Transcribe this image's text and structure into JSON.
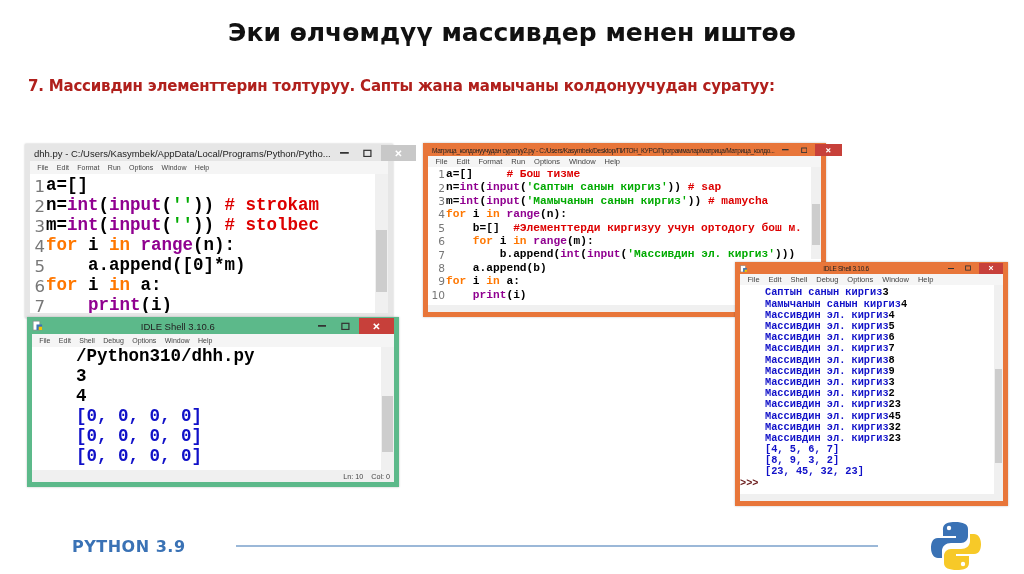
{
  "slide_title": "Эки өлчөмдүү массивдер менен иштөө",
  "subtitle": "7. Массивдин элементтерин толтуруу. Сапты жана мамычаны колдонуучудан суратуу:",
  "windows": [
    {
      "kind": "editor",
      "title": "dhh.py - C:/Users/Kasymbek/AppData/Local/Programs/Python/Pytho...",
      "color": "#e6e6e6",
      "active": false,
      "menu": [
        "File",
        "Edit",
        "Format",
        "Run",
        "Options",
        "Window",
        "Help"
      ],
      "lines": [
        {
          "number": "1",
          "tokens": [
            {
              "kind": "plain",
              "text": "a=[]"
            }
          ]
        },
        {
          "number": "2",
          "tokens": [
            {
              "kind": "plain",
              "text": "n="
            },
            {
              "kind": "builtin",
              "text": "int"
            },
            {
              "kind": "plain",
              "text": "("
            },
            {
              "kind": "builtin",
              "text": "input"
            },
            {
              "kind": "plain",
              "text": "("
            },
            {
              "kind": "string",
              "text": "''"
            },
            {
              "kind": "plain",
              "text": ")) "
            },
            {
              "kind": "comment",
              "text": "# strokam"
            }
          ]
        },
        {
          "number": "3",
          "tokens": [
            {
              "kind": "plain",
              "text": "m="
            },
            {
              "kind": "builtin",
              "text": "int"
            },
            {
              "kind": "plain",
              "text": "("
            },
            {
              "kind": "builtin",
              "text": "input"
            },
            {
              "kind": "plain",
              "text": "("
            },
            {
              "kind": "string",
              "text": "''"
            },
            {
              "kind": "plain",
              "text": ")) "
            },
            {
              "kind": "comment",
              "text": "# stolbec"
            }
          ]
        },
        {
          "number": "4",
          "tokens": [
            {
              "kind": "keyword",
              "text": "for"
            },
            {
              "kind": "plain",
              "text": " i "
            },
            {
              "kind": "keyword",
              "text": "in"
            },
            {
              "kind": "builtin",
              "text": " range"
            },
            {
              "kind": "plain",
              "text": "(n):"
            }
          ]
        },
        {
          "number": "5",
          "tokens": [
            {
              "kind": "plain",
              "text": "    a.append([0]*m)"
            }
          ]
        },
        {
          "number": "6",
          "tokens": [
            {
              "kind": "keyword",
              "text": "for"
            },
            {
              "kind": "plain",
              "text": " i "
            },
            {
              "kind": "keyword",
              "text": "in"
            },
            {
              "kind": "plain",
              "text": " a:"
            }
          ]
        },
        {
          "number": "7",
          "tokens": [
            {
              "kind": "builtin",
              "text": "    print"
            },
            {
              "kind": "plain",
              "text": "(i)"
            }
          ]
        }
      ]
    },
    {
      "kind": "shell",
      "title": "IDLE Shell 3.10.6",
      "color": "#5cb98a",
      "active": true,
      "menu": [
        "File",
        "Edit",
        "Shell",
        "Debug",
        "Options",
        "Window",
        "Help"
      ],
      "lines": [
        {
          "tokens": [
            {
              "kind": "plain",
              "text": "/Python310/dhh.py"
            }
          ]
        },
        {
          "tokens": [
            {
              "kind": "input",
              "text": "3"
            }
          ]
        },
        {
          "tokens": [
            {
              "kind": "input",
              "text": "4"
            }
          ]
        },
        {
          "tokens": [
            {
              "kind": "output",
              "text": "[0, 0, 0, 0]"
            }
          ]
        },
        {
          "tokens": [
            {
              "kind": "output",
              "text": "[0, 0, 0, 0]"
            }
          ]
        },
        {
          "tokens": [
            {
              "kind": "output",
              "text": "[0, 0, 0, 0]"
            }
          ]
        }
      ],
      "status": [
        "Ln: 10",
        "Col: 0"
      ]
    },
    {
      "kind": "editor",
      "title": "Матрица_колдонуучудан суратуу2.py - C:/Users/Kasymbek/Desktop/ПИТОН_КУРС/Программалар/матрица/Матрица_колдо...",
      "color": "#e8763a",
      "active": true,
      "menu": [
        "File",
        "Edit",
        "Format",
        "Run",
        "Options",
        "Window",
        "Help"
      ],
      "lines": [
        {
          "number": "1",
          "tokens": [
            {
              "kind": "plain",
              "text": "a=[]     "
            },
            {
              "kind": "comment",
              "text": "# Бош тизме"
            }
          ]
        },
        {
          "number": "2",
          "tokens": [
            {
              "kind": "plain",
              "text": "n="
            },
            {
              "kind": "builtin",
              "text": "int"
            },
            {
              "kind": "plain",
              "text": "("
            },
            {
              "kind": "builtin",
              "text": "input"
            },
            {
              "kind": "plain",
              "text": "("
            },
            {
              "kind": "string",
              "text": "'Саптын санын киргиз'"
            },
            {
              "kind": "plain",
              "text": ")) "
            },
            {
              "kind": "comment",
              "text": "# sap"
            }
          ]
        },
        {
          "number": "3",
          "tokens": [
            {
              "kind": "plain",
              "text": "m="
            },
            {
              "kind": "builtin",
              "text": "int"
            },
            {
              "kind": "plain",
              "text": "("
            },
            {
              "kind": "builtin",
              "text": "input"
            },
            {
              "kind": "plain",
              "text": "("
            },
            {
              "kind": "string",
              "text": "'Мамычанын санын киргиз'"
            },
            {
              "kind": "plain",
              "text": ")) "
            },
            {
              "kind": "comment",
              "text": "# mamycha"
            }
          ]
        },
        {
          "number": "4",
          "tokens": [
            {
              "kind": "keyword",
              "text": "for"
            },
            {
              "kind": "plain",
              "text": " i "
            },
            {
              "kind": "keyword",
              "text": "in"
            },
            {
              "kind": "builtin",
              "text": " range"
            },
            {
              "kind": "plain",
              "text": "(n):"
            }
          ]
        },
        {
          "number": "5",
          "tokens": [
            {
              "kind": "plain",
              "text": "    b=[]  "
            },
            {
              "kind": "comment",
              "text": "#Элементтерди киргизуу учун ортодогу бош м."
            }
          ]
        },
        {
          "number": "6",
          "tokens": [
            {
              "kind": "keyword",
              "text": "    for"
            },
            {
              "kind": "plain",
              "text": " i "
            },
            {
              "kind": "keyword",
              "text": "in"
            },
            {
              "kind": "builtin",
              "text": " range"
            },
            {
              "kind": "plain",
              "text": "(m):"
            }
          ]
        },
        {
          "number": "7",
          "tokens": [
            {
              "kind": "plain",
              "text": "        b.append("
            },
            {
              "kind": "builtin",
              "text": "int"
            },
            {
              "kind": "plain",
              "text": "("
            },
            {
              "kind": "builtin",
              "text": "input"
            },
            {
              "kind": "plain",
              "text": "("
            },
            {
              "kind": "string",
              "text": "'Массивдин эл. киргиз'"
            },
            {
              "kind": "plain",
              "text": ")))"
            }
          ]
        },
        {
          "number": "8",
          "tokens": [
            {
              "kind": "plain",
              "text": "    a.append(b)"
            }
          ]
        },
        {
          "number": "9",
          "tokens": [
            {
              "kind": "keyword",
              "text": "for"
            },
            {
              "kind": "plain",
              "text": " i "
            },
            {
              "kind": "keyword",
              "text": "in"
            },
            {
              "kind": "plain",
              "text": " a:"
            }
          ]
        },
        {
          "number": "10",
          "tokens": [
            {
              "kind": "builtin",
              "text": "    print"
            },
            {
              "kind": "plain",
              "text": "(i)"
            }
          ]
        }
      ]
    },
    {
      "kind": "shell",
      "title": "IDLE Shell 3.10.6",
      "color": "#e8763a",
      "active": true,
      "menu": [
        "File",
        "Edit",
        "Shell",
        "Debug",
        "Options",
        "Window",
        "Help"
      ],
      "lines": [
        {
          "tokens": [
            {
              "kind": "output",
              "text": "Саптын санын киргиз"
            },
            {
              "kind": "input",
              "text": "3"
            }
          ]
        },
        {
          "tokens": [
            {
              "kind": "output",
              "text": "Мамычанын санын киргиз"
            },
            {
              "kind": "input",
              "text": "4"
            }
          ]
        },
        {
          "tokens": [
            {
              "kind": "output",
              "text": "Массивдин эл. киргиз"
            },
            {
              "kind": "input",
              "text": "4"
            }
          ]
        },
        {
          "tokens": [
            {
              "kind": "output",
              "text": "Массивдин эл. киргиз"
            },
            {
              "kind": "input",
              "text": "5"
            }
          ]
        },
        {
          "tokens": [
            {
              "kind": "output",
              "text": "Массивдин эл. киргиз"
            },
            {
              "kind": "input",
              "text": "6"
            }
          ]
        },
        {
          "tokens": [
            {
              "kind": "output",
              "text": "Массивдин эл. киргиз"
            },
            {
              "kind": "input",
              "text": "7"
            }
          ]
        },
        {
          "tokens": [
            {
              "kind": "output",
              "text": "Массивдин эл. киргиз"
            },
            {
              "kind": "input",
              "text": "8"
            }
          ]
        },
        {
          "tokens": [
            {
              "kind": "output",
              "text": "Массивдин эл. киргиз"
            },
            {
              "kind": "input",
              "text": "9"
            }
          ]
        },
        {
          "tokens": [
            {
              "kind": "output",
              "text": "Массивдин эл. киргиз"
            },
            {
              "kind": "input",
              "text": "3"
            }
          ]
        },
        {
          "tokens": [
            {
              "kind": "output",
              "text": "Массивдин эл. киргиз"
            },
            {
              "kind": "input",
              "text": "2"
            }
          ]
        },
        {
          "tokens": [
            {
              "kind": "output",
              "text": "Массивдин эл. киргиз"
            },
            {
              "kind": "input",
              "text": "23"
            }
          ]
        },
        {
          "tokens": [
            {
              "kind": "output",
              "text": "Массивдин эл. киргиз"
            },
            {
              "kind": "input",
              "text": "45"
            }
          ]
        },
        {
          "tokens": [
            {
              "kind": "output",
              "text": "Массивдин эл. киргиз"
            },
            {
              "kind": "input",
              "text": "32"
            }
          ]
        },
        {
          "tokens": [
            {
              "kind": "output",
              "text": "Массивдин эл. киргиз"
            },
            {
              "kind": "input",
              "text": "23"
            }
          ]
        },
        {
          "tokens": [
            {
              "kind": "output",
              "text": "[4, 5, 6, 7]"
            }
          ]
        },
        {
          "tokens": [
            {
              "kind": "output",
              "text": "[8, 9, 3, 2]"
            }
          ]
        },
        {
          "tokens": [
            {
              "kind": "output",
              "text": "[23, 45, 32, 23]"
            }
          ]
        },
        {
          "prompt": ">>>"
        }
      ]
    }
  ],
  "footer": {
    "brand": "PYTHON 3.9"
  }
}
